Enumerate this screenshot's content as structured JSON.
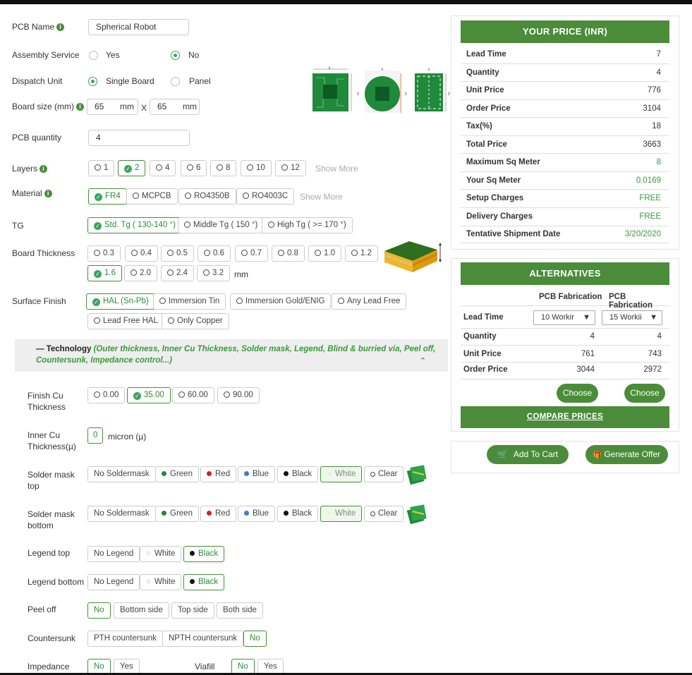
{
  "form": {
    "pcb_name_label": "PCB Name",
    "pcb_name_value": "Spherical Robot",
    "assembly_label": "Assembly Service",
    "assembly_yes": "Yes",
    "assembly_no": "No",
    "dispatch_label": "Dispatch Unit",
    "dispatch_single": "Single Board",
    "dispatch_panel": "Panel",
    "board_size_label": "Board size (mm)",
    "board_w": "65",
    "board_h": "65",
    "mm": "mm",
    "x": "X",
    "qty_label": "PCB quantity",
    "qty_value": "4",
    "layers_label": "Layers",
    "layers": [
      "1",
      "2",
      "4",
      "6",
      "8",
      "10",
      "12"
    ],
    "layers_selected": "2",
    "show_more": "Show More",
    "material_label": "Material",
    "materials": [
      "FR4",
      "MCPCB",
      "RO4350B",
      "RO4003C"
    ],
    "tg_label": "TG",
    "tg_options": [
      "Std. Tg ( 130-140 °)",
      "Middle Tg ( 150 °)",
      "High Tg ( >= 170 °)"
    ],
    "thickness_label": "Board Thickness",
    "thickness_row1": [
      "0.3",
      "0.4",
      "0.5",
      "0.6",
      "0.7",
      "0.8",
      "1.0",
      "1.2"
    ],
    "thickness_row2": [
      "1.6",
      "2.0",
      "2.4",
      "3.2"
    ],
    "thickness_unit": "mm",
    "surface_label": "Surface Finish",
    "surface_row1": [
      "HAL (Sn-Pb)",
      "Immersion Tin",
      "Immersion Gold/ENIG",
      "Any Lead Free"
    ],
    "surface_row2": [
      "Lead Free HAL",
      "Only Copper"
    ],
    "tech_title": "Technology",
    "tech_desc_line1": "(Outer thickness, Inner Cu Thickness, Solder mask, Legend, Blind & burried via, Peel off,",
    "tech_desc_line2": "Countersunk, Impedance control...)",
    "finish_cu_label_1": "Finish Cu",
    "finish_cu_label_2": "Thickness",
    "finish_cu": [
      "0.00",
      "35.00",
      "60.00",
      "90.00"
    ],
    "inner_cu_label_1": "Inner Cu",
    "inner_cu_label_2": "Thickness(µ)",
    "inner_cu_value": "0",
    "inner_cu_unit": "micron (µ)",
    "mask_top_label_1": "Solder mask",
    "mask_top_label_2": "top",
    "mask_bottom_label_1": "Solder mask",
    "mask_bottom_label_2": "bottom",
    "mask_options": [
      "No Soldermask",
      "Green",
      "Red",
      "Blue",
      "Black",
      "White",
      "Clear"
    ],
    "legend_top_label": "Legend top",
    "legend_bottom_label": "Legend bottom",
    "legend_options": [
      "No Legend",
      "White",
      "Black"
    ],
    "peel_label": "Peel off",
    "peel_options": [
      "No",
      "Bottom side",
      "Top side",
      "Both side"
    ],
    "countersunk_label": "Countersunk",
    "countersunk_options": [
      "PTH countersunk",
      "NPTH countersunk",
      "No"
    ],
    "impedance_label": "Impedance",
    "impedance_options": [
      "No",
      "Yes"
    ],
    "viafill_label": "Viafill",
    "viafill_options": [
      "No",
      "Yes"
    ]
  },
  "price": {
    "title": "YOUR PRICE (INR)",
    "rows": [
      {
        "k": "Lead Time",
        "v": "7"
      },
      {
        "k": "Quantity",
        "v": "4"
      },
      {
        "k": "Unit Price",
        "v": "776"
      },
      {
        "k": "Order Price",
        "v": "3104"
      },
      {
        "k": "Tax(%)",
        "v": "18"
      },
      {
        "k": "Total Price",
        "v": "3663"
      },
      {
        "k": "Maximum Sq Meter",
        "v": "8"
      },
      {
        "k": "Your Sq Meter",
        "v": "0.0169"
      },
      {
        "k": "Setup Charges",
        "v": "FREE"
      },
      {
        "k": "Delivery Charges",
        "v": "FREE"
      },
      {
        "k": "Tentative Shipment Date",
        "v": "3/20/2020"
      }
    ]
  },
  "alternatives": {
    "title": "ALTERNATIVES",
    "col1": "PCB Fabrication",
    "col2": "PCB Fabrication",
    "lead_time_label": "Lead Time",
    "lead_1": "10 Workir",
    "lead_2": "15 Workii",
    "qty_label": "Quantity",
    "qty_1": "4",
    "qty_2": "4",
    "unit_label": "Unit Price",
    "unit_1": "761",
    "unit_2": "743",
    "order_label": "Order Price",
    "order_1": "3044",
    "order_2": "2972",
    "choose": "Choose",
    "compare": "COMPARE PRICES"
  },
  "actions": {
    "add_to_cart": "Add To Cart",
    "generate_offer": "Generate Offer"
  },
  "colors": {
    "accent": "#4a8c3a",
    "check": "#3aa55d"
  }
}
